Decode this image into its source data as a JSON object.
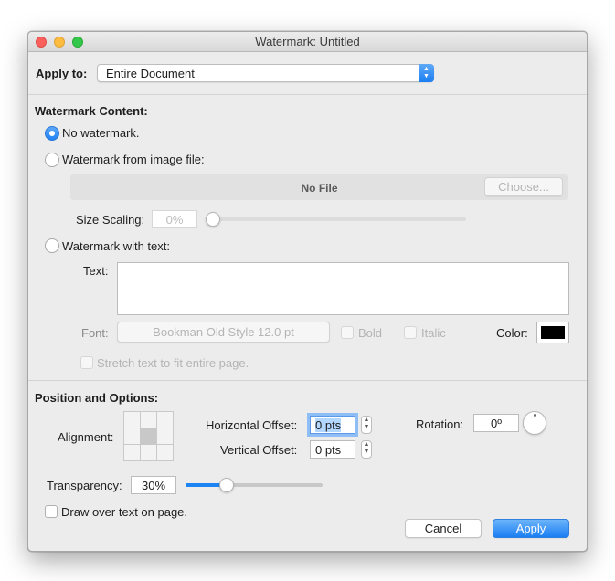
{
  "window": {
    "title": "Watermark: Untitled"
  },
  "apply_to": {
    "label": "Apply to:",
    "value": "Entire Document"
  },
  "content": {
    "heading": "Watermark Content:",
    "radio_none": "No watermark.",
    "radio_image": "Watermark from image file:",
    "file_name": "No File",
    "choose_button": "Choose...",
    "size_scaling_label": "Size Scaling:",
    "size_scaling_value": "0%",
    "radio_text": "Watermark with text:",
    "text_label": "Text:",
    "text_value": "",
    "font_label": "Font:",
    "font_button": "Bookman Old Style 12.0 pt",
    "bold_label": "Bold",
    "italic_label": "Italic",
    "color_label": "Color:",
    "color_value": "#000000",
    "stretch_label": "Stretch text to fit entire page."
  },
  "position": {
    "heading": "Position and Options:",
    "alignment_label": "Alignment:",
    "h_offset_label": "Horizontal Offset:",
    "h_offset_value": "0 pts",
    "v_offset_label": "Vertical Offset:",
    "v_offset_value": "0 pts",
    "rotation_label": "Rotation:",
    "rotation_value": "0º",
    "transparency_label": "Transparency:",
    "transparency_value": "30%",
    "transparency_level": 0.3,
    "draw_over_label": "Draw over text on page."
  },
  "buttons": {
    "cancel": "Cancel",
    "apply": "Apply"
  },
  "colors": {
    "accent": "#1b7ff3"
  }
}
